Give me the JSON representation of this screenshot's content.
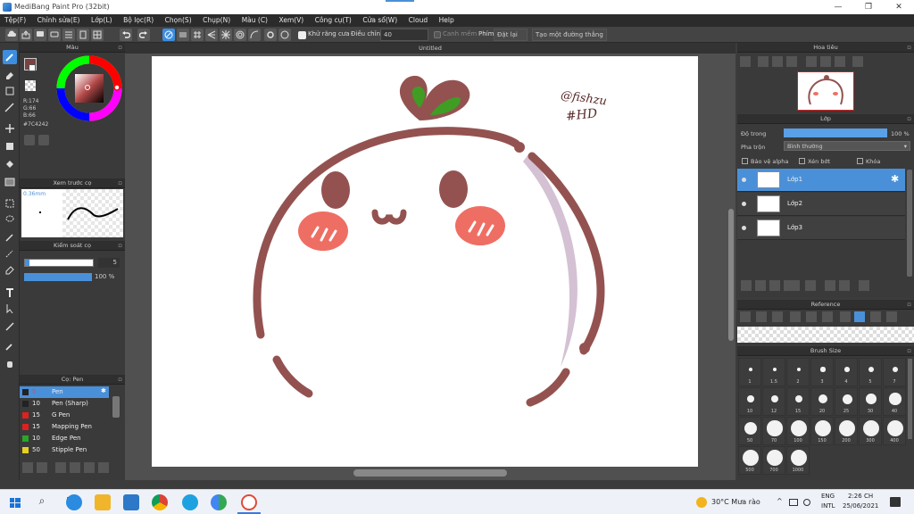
{
  "window": {
    "title": "MediBang Paint Pro (32bit)",
    "minimize_glyph": "—",
    "restore_glyph": "❐",
    "close_glyph": "✕"
  },
  "menu": [
    "Tệp(F)",
    "Chỉnh sửa(E)",
    "Lớp(L)",
    "Bộ lọc(R)",
    "Chọn(S)",
    "Chụp(N)",
    "Màu (C)",
    "Xem(V)",
    "Công cụ(T)",
    "Cửa sổ(W)",
    "Cloud",
    "Help"
  ],
  "toolbar": {
    "antialias_label": "Khử răng cưa",
    "adjust_label": "Điều chỉnh",
    "adjust_value": "40",
    "snap_label": "Canh mềm",
    "key_label": "Phím",
    "reset_label": "Đặt lại",
    "create_line_label": "Tạo một đường thẳng"
  },
  "color_panel": {
    "title": "Màu",
    "r": "R:174",
    "g": "G:66",
    "b": "B:66",
    "hex": "#7C4242",
    "fg_color": "#7c4242",
    "bg_color": "#ffffff"
  },
  "brush_preview": {
    "title": "Xem trước cọ",
    "size_label": "0.36mm"
  },
  "brush_control": {
    "title": "Kiểm soát cọ",
    "size_value": "5",
    "opacity_value": "100 %"
  },
  "brush_list": {
    "title": "Cọ: Pen",
    "items": [
      {
        "size": "5",
        "name": "Pen",
        "color": "#222222",
        "selected": true
      },
      {
        "size": "10",
        "name": "Pen (Sharp)",
        "color": "#222222",
        "selected": false
      },
      {
        "size": "15",
        "name": "G Pen",
        "color": "#e02020",
        "selected": false
      },
      {
        "size": "15",
        "name": "Mapping Pen",
        "color": "#e02020",
        "selected": false
      },
      {
        "size": "10",
        "name": "Edge Pen",
        "color": "#2aa52a",
        "selected": false
      },
      {
        "size": "50",
        "name": "Stipple Pen",
        "color": "#e6d020",
        "selected": false
      }
    ]
  },
  "canvas": {
    "doc_title": "Untitled",
    "signature_line1": "@fishzu",
    "signature_line2": "#HD",
    "colors": {
      "outline": "#935250",
      "leaf": "#3f9d24",
      "blush": "#ef6e63",
      "shade": "#d4c1d3"
    }
  },
  "navigator": {
    "title": "Hoa tiêu"
  },
  "layer_panel": {
    "title": "Lớp",
    "opacity_label": "Độ trong",
    "opacity_value": "100 %",
    "blend_label": "Pha trộn",
    "blend_value": "Bình thường",
    "protect_alpha": "Bảo vệ alpha",
    "clipping": "Xén bớt",
    "lock": "Khóa",
    "layers": [
      "Lớp1",
      "Lớp2",
      "Lớp3"
    ]
  },
  "reference": {
    "title": "Reference"
  },
  "brush_size": {
    "title": "Brush Size",
    "sizes": [
      "1",
      "1.5",
      "2",
      "3",
      "4",
      "5",
      "7",
      "10",
      "12",
      "15",
      "20",
      "25",
      "30",
      "40",
      "50",
      "70",
      "100",
      "150",
      "200",
      "300",
      "400",
      "500",
      "700",
      "1000"
    ]
  },
  "taskbar": {
    "weather": "30°C Mưa rào",
    "lang_line1": "ENG",
    "lang_line2": "INTL",
    "time": "2:26 CH",
    "date": "25/06/2021",
    "search_glyph": "⌕",
    "taskview_glyph": "⊟"
  }
}
